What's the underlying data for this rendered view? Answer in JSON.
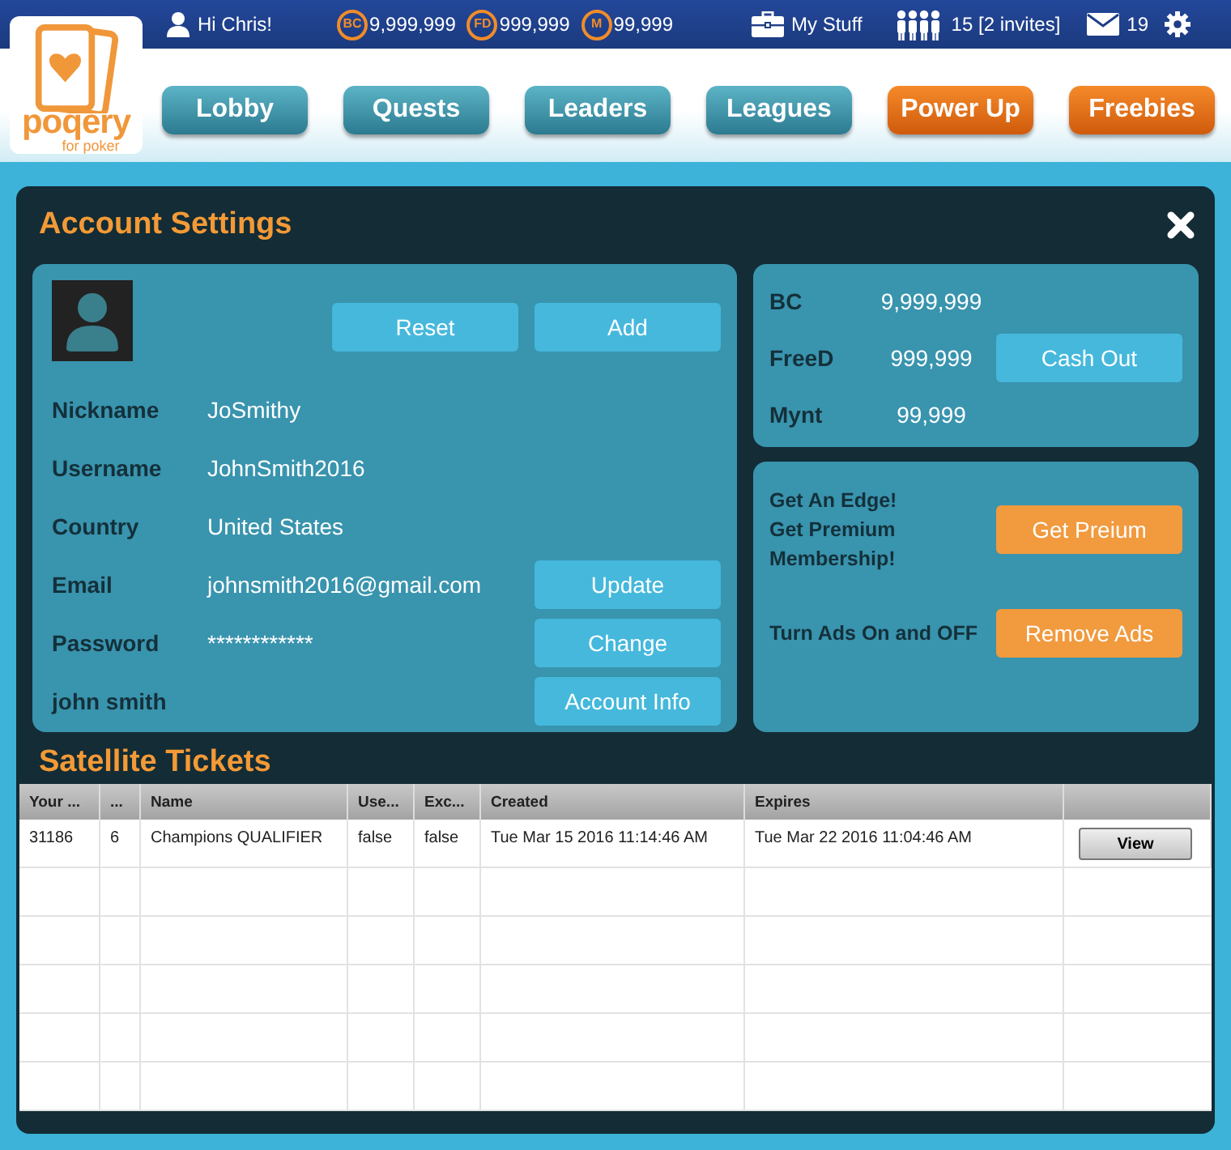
{
  "top_bar": {
    "greeting": "Hi Chris!",
    "currencies": [
      {
        "symbol": "BC",
        "amount": "9,999,999"
      },
      {
        "symbol": "FD",
        "amount": "999,999"
      },
      {
        "symbol": "M",
        "amount": "99,999"
      }
    ],
    "my_stuff": "My Stuff",
    "friends": "15 [2 invites]",
    "messages": "19"
  },
  "logo": {
    "name": "poqery",
    "tagline": "for poker"
  },
  "nav": [
    {
      "label": "Lobby",
      "kind": "primary"
    },
    {
      "label": "Quests",
      "kind": "primary"
    },
    {
      "label": "Leaders",
      "kind": "primary"
    },
    {
      "label": "Leagues",
      "kind": "primary"
    },
    {
      "label": "Power Up",
      "kind": "promo"
    },
    {
      "label": "Freebies",
      "kind": "promo"
    }
  ],
  "panel": {
    "title": "Account Settings"
  },
  "profile": {
    "buttons": [
      "Reset",
      "Add"
    ],
    "fields": [
      {
        "label": "Nickname",
        "value": "JoSmithy"
      },
      {
        "label": "Username",
        "value": "JohnSmith2016"
      },
      {
        "label": "Country",
        "value": "United States"
      },
      {
        "label": "Email",
        "value": "johnsmith2016@gmail.com",
        "action": "Update"
      },
      {
        "label": "Password",
        "value": "************",
        "action": "Change"
      },
      {
        "label": "john smith",
        "action": "Account Info"
      }
    ]
  },
  "balances": [
    {
      "label": "BC",
      "amount": "9,999,999"
    },
    {
      "label": "FreeD",
      "amount": "999,999",
      "action": "Cash Out"
    },
    {
      "label": "Mynt",
      "amount": "99,999"
    }
  ],
  "offers": [
    {
      "text": "Get An Edge! Get Premium Membership!",
      "action": "Get  Preium"
    },
    {
      "text": "Turn Ads On and OFF",
      "action": "Remove Ads"
    }
  ],
  "tickets": {
    "title": "Satellite Tickets",
    "columns": [
      "Your ...",
      "...",
      "Name",
      "Use...",
      "Exc...",
      "Created",
      "Expires"
    ],
    "rows": [
      {
        "cells": [
          "31186",
          "6",
          "Champions QUALIFIER",
          "false",
          "false",
          "Tue Mar 15 2016 11:14:46 AM",
          "Tue Mar 22 2016 11:04:46 AM"
        ],
        "action": "View"
      }
    ]
  }
}
